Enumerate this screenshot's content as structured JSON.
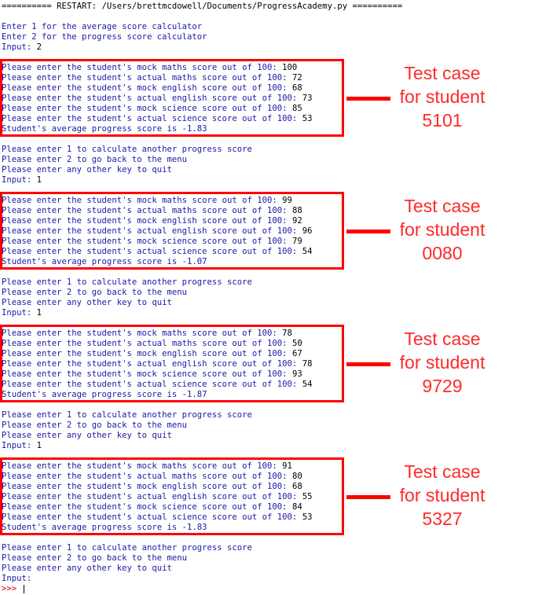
{
  "header": "========== RESTART: /Users/brettmcdowell/Documents/ProgressAcademy.py ==========",
  "menu": {
    "line1": "Enter 1 for the average score calculator",
    "line2": "Enter 2 for the progress score calculator",
    "input_prompt": "Input: ",
    "input_value": "2"
  },
  "prompts": {
    "mock_maths": "Please enter the student's mock maths score out of 100: ",
    "actual_maths": "Please enter the student's actual maths score out of 100: ",
    "mock_english": "Please enter the student's mock english score out of 100: ",
    "actual_english": "Please enter the student's actual english score out of 100: ",
    "mock_science": "Please enter the student's mock science score out of 100: ",
    "actual_science": "Please enter the student's actual science score out of 100: ",
    "result_prefix": "Student's average progress score is "
  },
  "again_menu": {
    "line1": "Please enter 1 to calculate another progress score",
    "line2": "Please enter 2 to go back to the menu",
    "line3": "Please enter any other key to quit",
    "input_prompt": "Input: "
  },
  "test_cases": [
    {
      "scores": [
        "100",
        "72",
        "68",
        "73",
        "85",
        "53"
      ],
      "result": "-1.83",
      "label_line1": "Test case",
      "label_line2": "for student",
      "student_id": "5101",
      "next_input": "1"
    },
    {
      "scores": [
        "99",
        "88",
        "92",
        "96",
        "79",
        "54"
      ],
      "result": "-1.07",
      "label_line1": "Test case",
      "label_line2": "for student",
      "student_id": "0080",
      "next_input": "1"
    },
    {
      "scores": [
        "78",
        "50",
        "67",
        "78",
        "93",
        "54"
      ],
      "result": "-1.87",
      "label_line1": "Test case",
      "label_line2": "for student",
      "student_id": "9729",
      "next_input": "1"
    },
    {
      "scores": [
        "91",
        "80",
        "68",
        "55",
        "84",
        "53"
      ],
      "result": "-1.83",
      "label_line1": "Test case",
      "label_line2": "for student",
      "student_id": "5327",
      "next_input": ""
    }
  ],
  "shell_prompt": ">>> ",
  "colors": {
    "prompt_text": "#1a1aa6",
    "user_input": "#000000",
    "annotation": "#ff2a2a",
    "box": "#ff0000"
  }
}
